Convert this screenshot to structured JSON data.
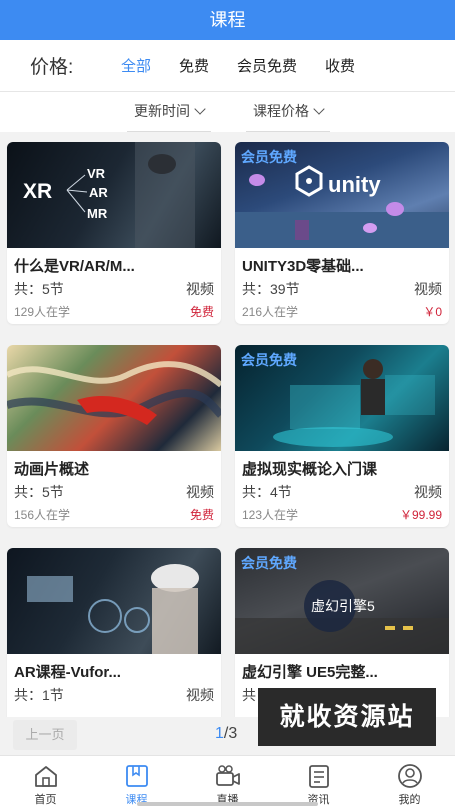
{
  "header": {
    "title": "课程"
  },
  "filter": {
    "label": "价格:",
    "options": [
      "全部",
      "免费",
      "会员免费",
      "收费"
    ],
    "active_index": 0
  },
  "sort": {
    "update_time": "更新时间",
    "course_price": "课程价格"
  },
  "courses": [
    {
      "title": "什么是VR/AR/M...",
      "sections": "共：5节",
      "type": "视频",
      "learners": "129人在学",
      "price": "免费",
      "badge": "",
      "thumb_text": [
        "XR",
        "VR",
        "AR",
        "MR"
      ]
    },
    {
      "title": "UNITY3D零基础...",
      "sections": "共：39节",
      "type": "视频",
      "learners": "216人在学",
      "price": "￥0",
      "badge": "会员免费",
      "thumb_text": [
        "unity"
      ]
    },
    {
      "title": "动画片概述",
      "sections": "共：5节",
      "type": "视频",
      "learners": "156人在学",
      "price": "免费",
      "badge": "",
      "thumb_text": []
    },
    {
      "title": "虚拟现实概论入门课",
      "sections": "共：4节",
      "type": "视频",
      "learners": "123人在学",
      "price": "￥99.99",
      "badge": "会员免费",
      "thumb_text": []
    },
    {
      "title": "AR课程-Vufor...",
      "sections": "共：1节",
      "type": "视频",
      "learners": "",
      "price": "",
      "badge": "",
      "thumb_text": []
    },
    {
      "title": "虚幻引擎 UE5完整...",
      "sections": "共",
      "type": "",
      "learners": "",
      "price": "",
      "badge": "会员免费",
      "thumb_text": [
        "虚幻引擎5"
      ]
    }
  ],
  "pager": {
    "prev": "上一页",
    "current": "1",
    "total": "/3"
  },
  "watermark": "就收资源站",
  "tabbar": {
    "items": [
      {
        "label": "首页",
        "icon": "home-icon"
      },
      {
        "label": "课程",
        "icon": "course-icon"
      },
      {
        "label": "直播",
        "icon": "live-camera-icon"
      },
      {
        "label": "资讯",
        "icon": "news-icon"
      },
      {
        "label": "我的",
        "icon": "user-icon"
      }
    ],
    "active_index": 1
  },
  "colors": {
    "accent": "#3d8bf2",
    "price_red": "#d0243a",
    "vip_badge": "#5fa8ff"
  }
}
